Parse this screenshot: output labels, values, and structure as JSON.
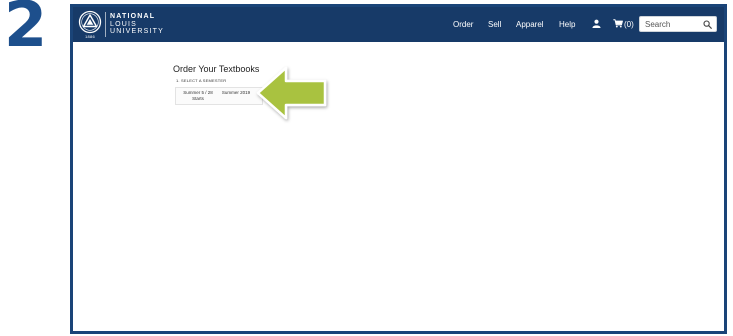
{
  "step_number": "2",
  "brand": {
    "line1": "NATIONAL",
    "line2": "LOUIS",
    "line3": "UNIVERSITY",
    "year": "1886",
    "logo_icon": "triangle-seal-icon"
  },
  "nav": {
    "items": [
      {
        "label": "Order"
      },
      {
        "label": "Sell"
      },
      {
        "label": "Apparel"
      },
      {
        "label": "Help"
      }
    ],
    "account_icon": "user-icon",
    "cart_icon": "cart-icon",
    "cart_count": "(0)",
    "search_placeholder": "Search",
    "search_icon": "search-icon"
  },
  "main": {
    "title": "Order Your Textbooks",
    "step_label": "1. SELECT A SEMESTER",
    "semesters": [
      {
        "line1": "Summer 5 / 28",
        "line2": "Starts"
      },
      {
        "line1": "Summer 2019",
        "line2": ""
      }
    ]
  },
  "colors": {
    "navbar": "#173a68",
    "frame_border": "#1a4478",
    "step_number": "#1d4f8c",
    "arrow": "#a9c23f"
  },
  "annotation_icon": "left-arrow-icon"
}
